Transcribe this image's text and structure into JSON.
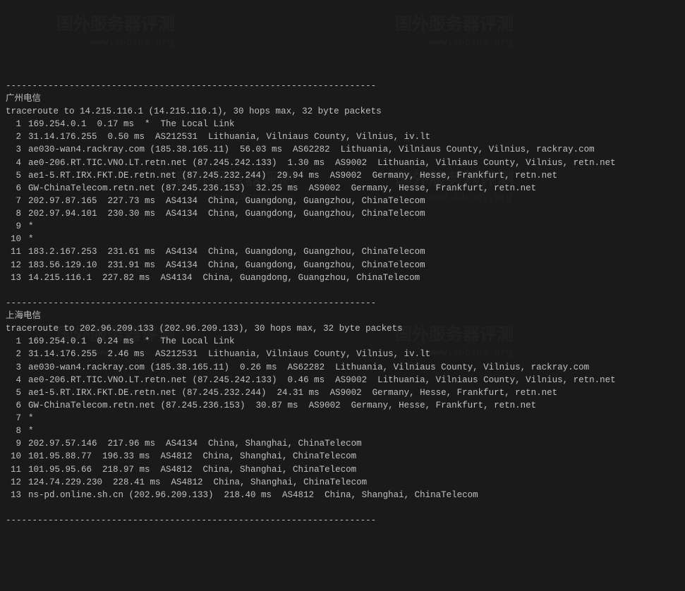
{
  "sections": [
    {
      "title": "广州电信",
      "header": "traceroute to 14.215.116.1 (14.215.116.1), 30 hops max, 32 byte packets",
      "hops": [
        {
          "n": "1",
          "t": "169.254.0.1  0.17 ms  *  The Local Link"
        },
        {
          "n": "2",
          "t": "31.14.176.255  0.50 ms  AS212531  Lithuania, Vilniaus County, Vilnius, iv.lt"
        },
        {
          "n": "3",
          "t": "ae030-wan4.rackray.com (185.38.165.11)  56.03 ms  AS62282  Lithuania, Vilniaus County, Vilnius, rackray.com"
        },
        {
          "n": "4",
          "t": "ae0-206.RT.TIC.VNO.LT.retn.net (87.245.242.133)  1.30 ms  AS9002  Lithuania, Vilniaus County, Vilnius, retn.net"
        },
        {
          "n": "5",
          "t": "ae1-5.RT.IRX.FKT.DE.retn.net (87.245.232.244)  29.94 ms  AS9002  Germany, Hesse, Frankfurt, retn.net"
        },
        {
          "n": "6",
          "t": "GW-ChinaTelecom.retn.net (87.245.236.153)  32.25 ms  AS9002  Germany, Hesse, Frankfurt, retn.net"
        },
        {
          "n": "7",
          "t": "202.97.87.165  227.73 ms  AS4134  China, Guangdong, Guangzhou, ChinaTelecom"
        },
        {
          "n": "8",
          "t": "202.97.94.101  230.30 ms  AS4134  China, Guangdong, Guangzhou, ChinaTelecom"
        },
        {
          "n": "9",
          "t": "*"
        },
        {
          "n": "10",
          "t": "*"
        },
        {
          "n": "11",
          "t": "183.2.167.253  231.61 ms  AS4134  China, Guangdong, Guangzhou, ChinaTelecom"
        },
        {
          "n": "12",
          "t": "183.56.129.10  231.91 ms  AS4134  China, Guangdong, Guangzhou, ChinaTelecom"
        },
        {
          "n": "13",
          "t": "14.215.116.1  227.82 ms  AS4134  China, Guangdong, Guangzhou, ChinaTelecom"
        }
      ]
    },
    {
      "title": "上海电信",
      "header": "traceroute to 202.96.209.133 (202.96.209.133), 30 hops max, 32 byte packets",
      "hops": [
        {
          "n": "1",
          "t": "169.254.0.1  0.24 ms  *  The Local Link"
        },
        {
          "n": "2",
          "t": "31.14.176.255  2.46 ms  AS212531  Lithuania, Vilniaus County, Vilnius, iv.lt"
        },
        {
          "n": "3",
          "t": "ae030-wan4.rackray.com (185.38.165.11)  0.26 ms  AS62282  Lithuania, Vilniaus County, Vilnius, rackray.com"
        },
        {
          "n": "4",
          "t": "ae0-206.RT.TIC.VNO.LT.retn.net (87.245.242.133)  0.46 ms  AS9002  Lithuania, Vilniaus County, Vilnius, retn.net"
        },
        {
          "n": "5",
          "t": "ae1-5.RT.IRX.FKT.DE.retn.net (87.245.232.244)  24.31 ms  AS9002  Germany, Hesse, Frankfurt, retn.net"
        },
        {
          "n": "6",
          "t": "GW-ChinaTelecom.retn.net (87.245.236.153)  30.87 ms  AS9002  Germany, Hesse, Frankfurt, retn.net"
        },
        {
          "n": "7",
          "t": "*"
        },
        {
          "n": "8",
          "t": "*"
        },
        {
          "n": "9",
          "t": "202.97.57.146  217.96 ms  AS4134  China, Shanghai, ChinaTelecom"
        },
        {
          "n": "10",
          "t": "101.95.88.77  196.33 ms  AS4812  China, Shanghai, ChinaTelecom"
        },
        {
          "n": "11",
          "t": "101.95.95.66  218.97 ms  AS4812  China, Shanghai, ChinaTelecom"
        },
        {
          "n": "12",
          "t": "124.74.229.230  228.41 ms  AS4812  China, Shanghai, ChinaTelecom"
        },
        {
          "n": "13",
          "t": "ns-pd.online.sh.cn (202.96.209.133)  218.40 ms  AS4812  China, Shanghai, ChinaTelecom"
        }
      ]
    }
  ],
  "divider": "----------------------------------------------------------------------",
  "watermark": {
    "main": "国外服务器评测",
    "sub": "-www.idcspy.org-"
  }
}
